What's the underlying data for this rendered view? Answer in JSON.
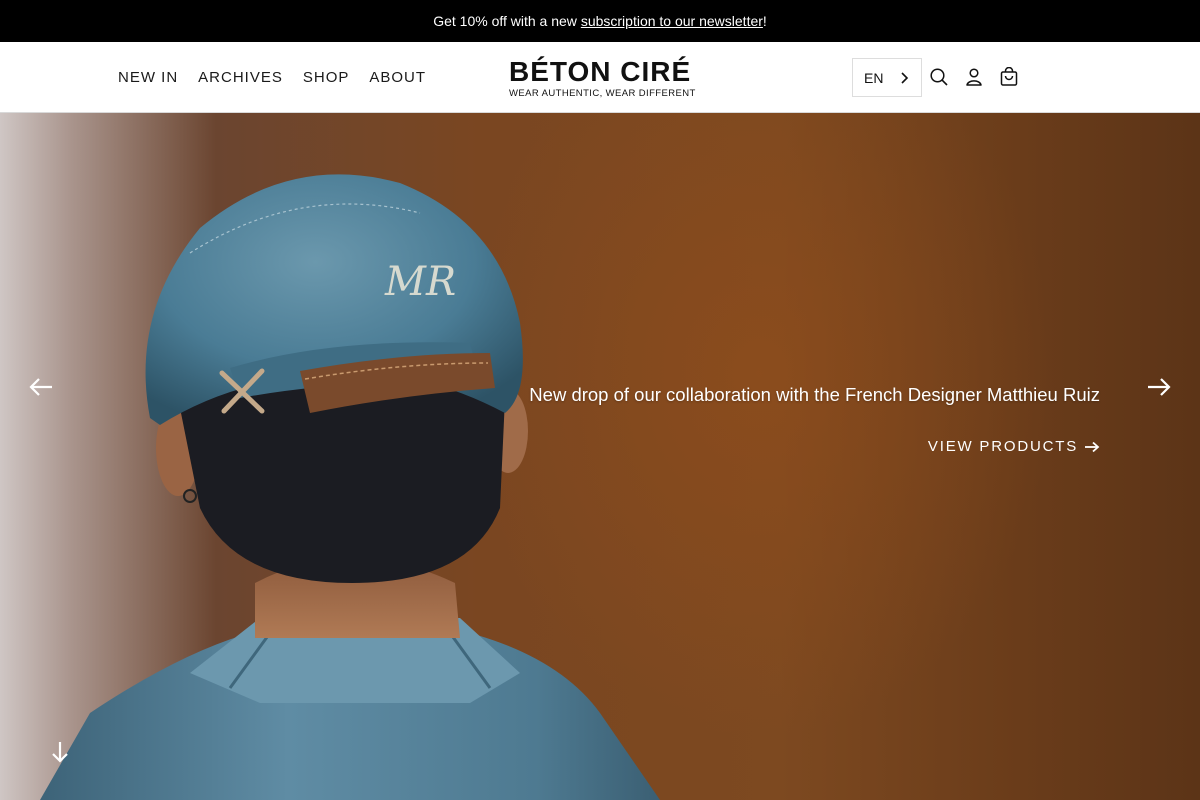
{
  "announcement": {
    "prefix": "Get 10% off with a new ",
    "link": "subscription to our newsletter",
    "suffix": "!"
  },
  "nav": {
    "items": [
      {
        "label": "NEW IN"
      },
      {
        "label": "ARCHIVES"
      },
      {
        "label": "SHOP"
      },
      {
        "label": "ABOUT"
      }
    ]
  },
  "logo": {
    "title": "BÉTON CIRÉ",
    "tagline": "WEAR AUTHENTIC, WEAR DIFFERENT"
  },
  "header": {
    "language": "EN",
    "icons": [
      "chevron-right-icon",
      "search-icon",
      "account-icon",
      "cart-icon"
    ]
  },
  "hero": {
    "caption": "New drop of our collaboration with the French Designer Matthieu Ruiz",
    "cta": "VIEW PRODUCTS",
    "icons": [
      "arrow-left-icon",
      "arrow-right-icon",
      "arrow-down-icon"
    ],
    "colors": {
      "background": "#7a4621",
      "cap": "#4f7e96",
      "shirt": "#5e8aa3",
      "hair": "#1b1c22"
    }
  }
}
